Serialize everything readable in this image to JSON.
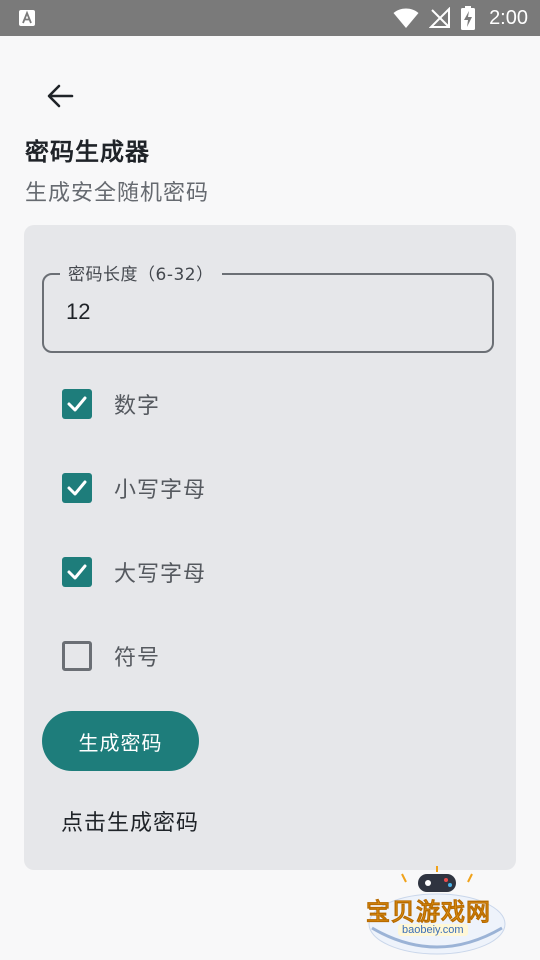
{
  "status_bar": {
    "time": "2:00",
    "icons": [
      "app-a-icon",
      "wifi-icon",
      "no-signal-icon",
      "battery-charging-icon"
    ]
  },
  "header": {
    "back_icon": "arrow-left-icon",
    "title": "密码生成器",
    "subtitle": "生成安全随机密码"
  },
  "form": {
    "length_label": "密码长度（6-32）",
    "length_value": "12",
    "options": [
      {
        "label": "数字",
        "checked": true
      },
      {
        "label": "小写字母",
        "checked": true
      },
      {
        "label": "大写字母",
        "checked": true
      },
      {
        "label": "符号",
        "checked": false
      }
    ],
    "generate_label": "生成密码",
    "result_text": "点击生成密码"
  },
  "colors": {
    "accent": "#1e7d7b",
    "card_background": "#e6e7ea",
    "page_background": "#f8f8f9"
  },
  "watermark": {
    "text": "宝贝游戏网",
    "url": "baobeiy.com"
  }
}
